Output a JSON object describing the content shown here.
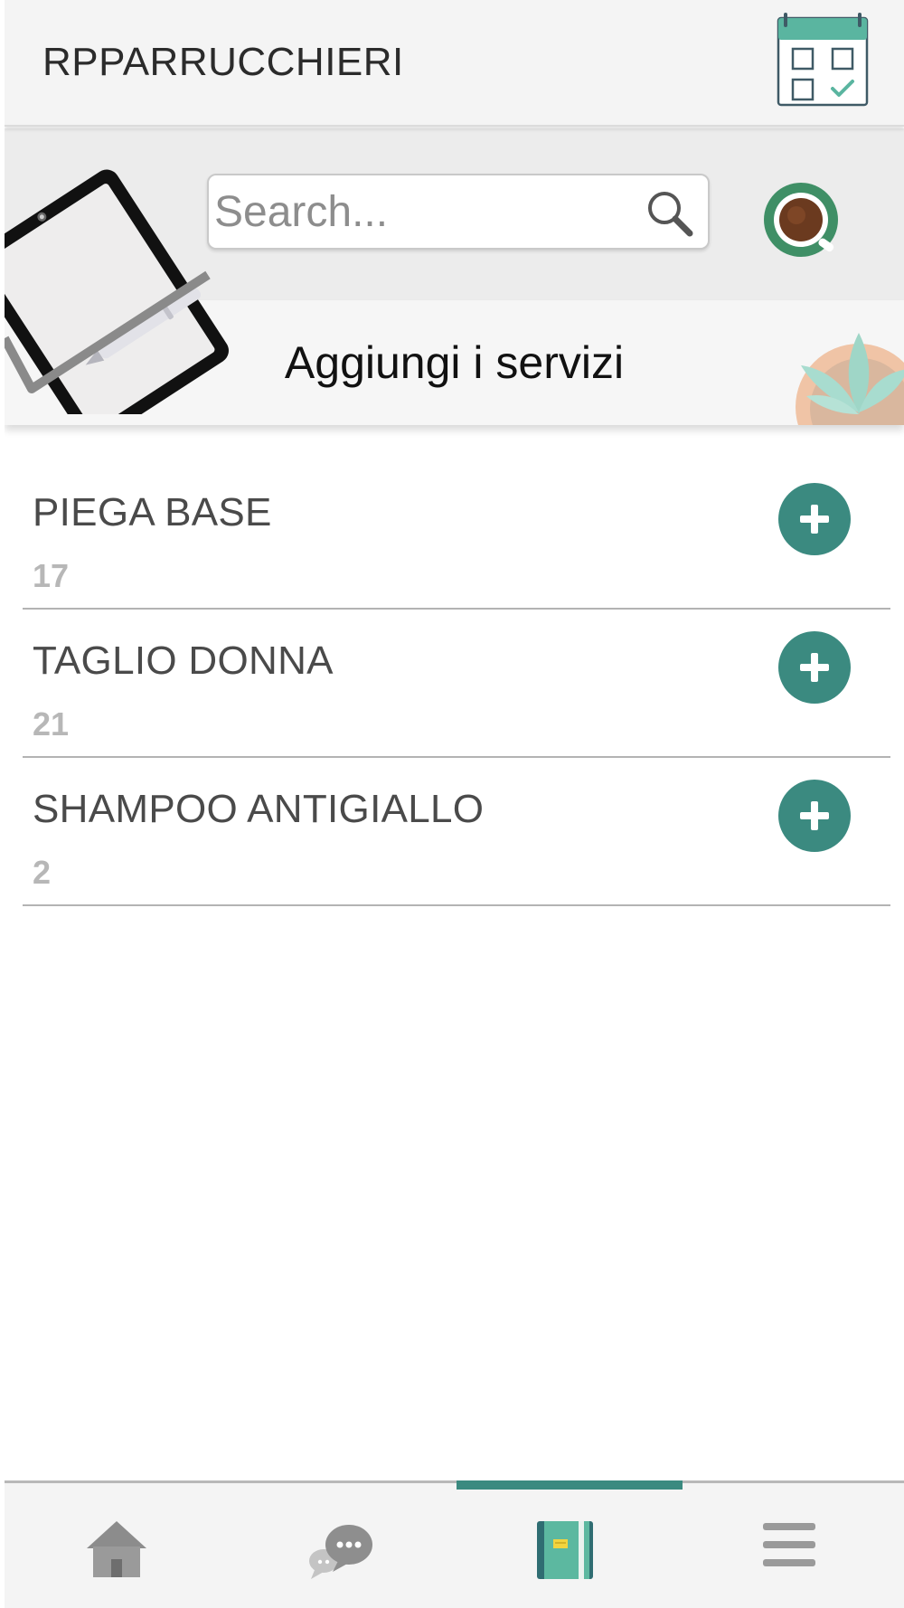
{
  "header": {
    "app_title": "RPPARRUCCHIERI",
    "calendar_icon": "calendar-check-icon"
  },
  "search": {
    "placeholder": "Search...",
    "value": "",
    "icon": "search-icon"
  },
  "banner": {
    "title": "Aggiungi i servizi"
  },
  "services": [
    {
      "name": "PIEGA BASE",
      "count": "17"
    },
    {
      "name": "TAGLIO DONNA",
      "count": "21"
    },
    {
      "name": "SHAMPOO ANTIGIALLO",
      "count": "2"
    }
  ],
  "bottom_nav": {
    "items": [
      {
        "icon": "home-icon",
        "active": false
      },
      {
        "icon": "chat-icon",
        "active": false
      },
      {
        "icon": "notebook-icon",
        "active": true
      },
      {
        "icon": "menu-icon",
        "active": false
      }
    ]
  },
  "colors": {
    "accent": "#3b8a80",
    "header_bg": "#f4f4f4",
    "count_text": "#b7b7b7"
  }
}
